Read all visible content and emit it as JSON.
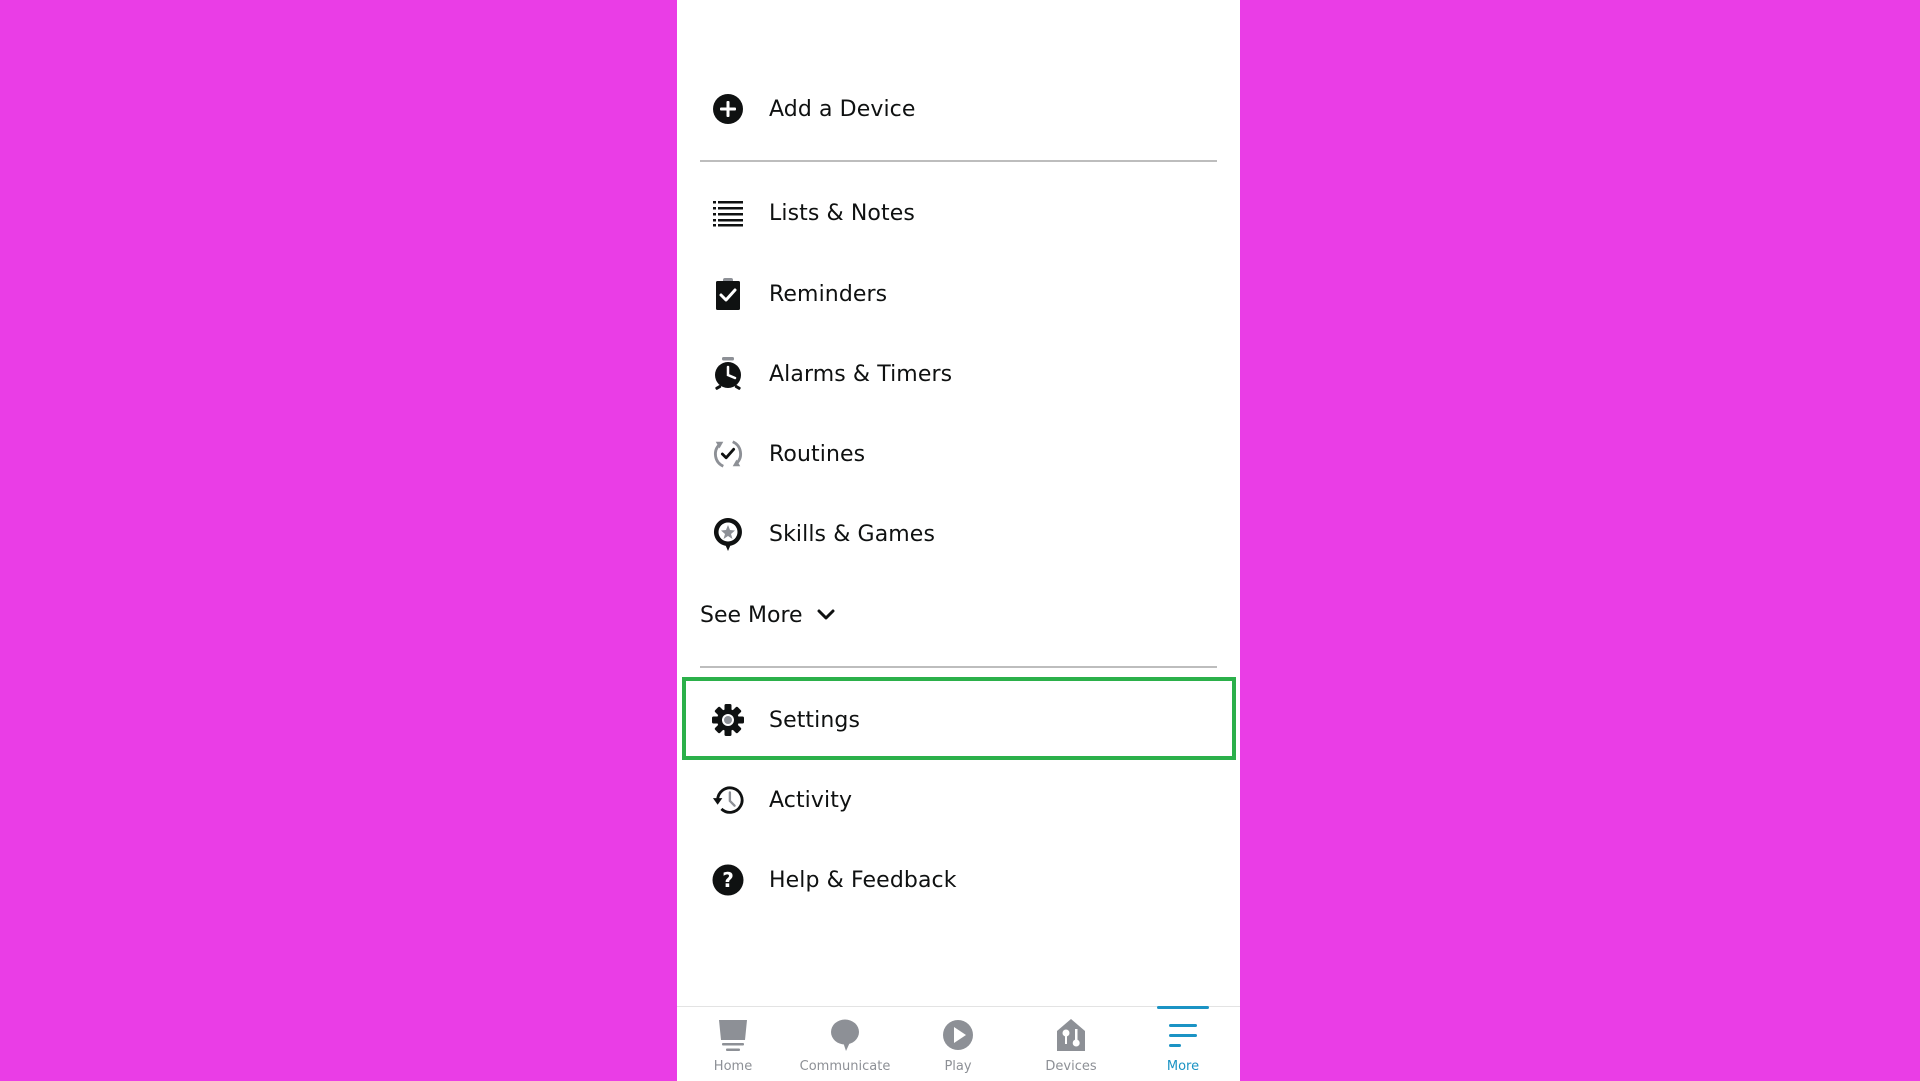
{
  "menu": {
    "add_device": {
      "label": "Add a Device",
      "icon": "plus-circle-icon"
    },
    "items": [
      {
        "label": "Lists & Notes",
        "icon": "list-icon"
      },
      {
        "label": "Reminders",
        "icon": "clipboard-check-icon"
      },
      {
        "label": "Alarms & Timers",
        "icon": "alarm-clock-icon"
      },
      {
        "label": "Routines",
        "icon": "routine-cycle-icon"
      },
      {
        "label": "Skills & Games",
        "icon": "skills-star-icon"
      }
    ],
    "see_more": {
      "label": "See More",
      "icon": "chevron-down-icon"
    },
    "bottom_items": [
      {
        "label": "Settings",
        "icon": "gear-icon",
        "highlighted": true
      },
      {
        "label": "Activity",
        "icon": "history-icon"
      },
      {
        "label": "Help & Feedback",
        "icon": "help-circle-icon"
      }
    ]
  },
  "highlight_color": "#2bb04a",
  "background_color": "#ea3de6",
  "accent_color": "#1b93c4",
  "bottom_nav": {
    "active": "More",
    "items": [
      {
        "label": "Home",
        "icon": "home-icon"
      },
      {
        "label": "Communicate",
        "icon": "chat-bubble-icon"
      },
      {
        "label": "Play",
        "icon": "play-icon"
      },
      {
        "label": "Devices",
        "icon": "devices-house-icon"
      },
      {
        "label": "More",
        "icon": "menu-lines-icon"
      }
    ]
  }
}
